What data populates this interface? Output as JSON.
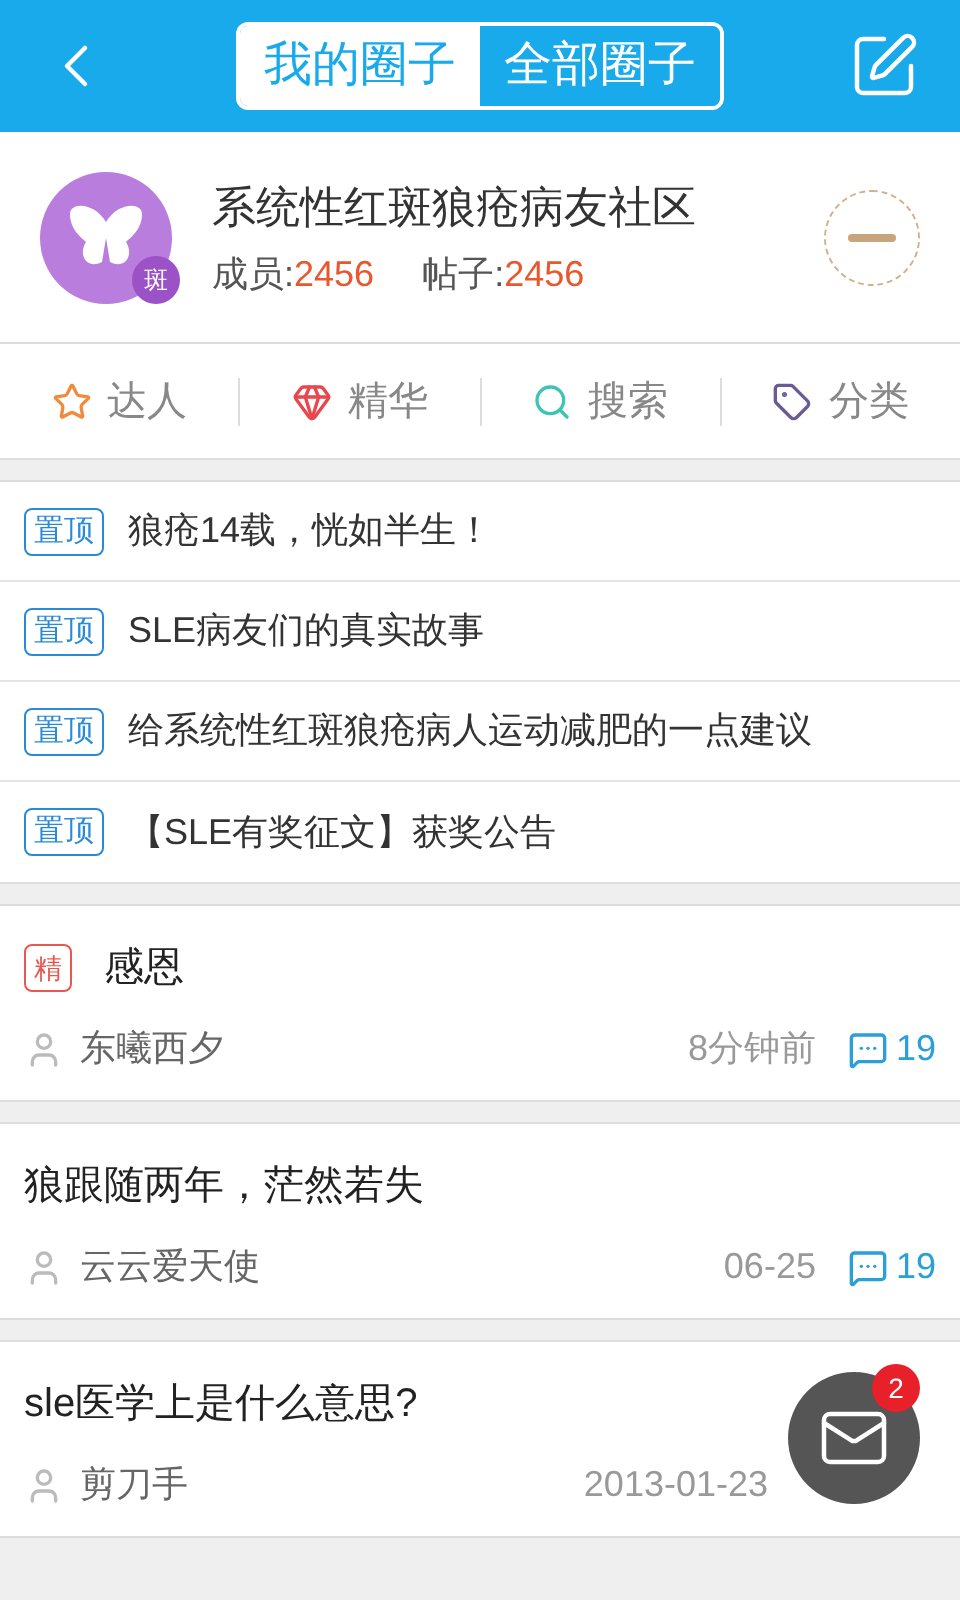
{
  "header": {
    "tabs": [
      {
        "label": "我的圈子",
        "selected": true
      },
      {
        "label": "全部圈子",
        "selected": false
      }
    ]
  },
  "community": {
    "avatar_badge": "斑",
    "name": "系统性红斑狼疮病友社区",
    "members_label": "成员:",
    "members": "2456",
    "posts_label": "帖子:",
    "posts": "2456"
  },
  "actions": [
    {
      "label": "达人",
      "kind": "star"
    },
    {
      "label": "精华",
      "kind": "diamond"
    },
    {
      "label": "搜索",
      "kind": "search"
    },
    {
      "label": "分类",
      "kind": "tag"
    }
  ],
  "pinned": [
    {
      "badge": "置顶",
      "title": "狼疮14载，恍如半生！"
    },
    {
      "badge": "置顶",
      "title": "SLE病友们的真实故事"
    },
    {
      "badge": "置顶",
      "title": "给系统性红斑狼疮病人运动减肥的一点建议"
    },
    {
      "badge": "置顶",
      "title": "【SLE有奖征文】获奖公告"
    }
  ],
  "posts": [
    {
      "badge": "精",
      "title": "感恩",
      "author": "东曦西夕",
      "time": "8分钟前",
      "comments": "19"
    },
    {
      "title": "狼跟随两年，茫然若失",
      "author": "云云爱天使",
      "time": "06-25",
      "comments": "19"
    },
    {
      "title": "sle医学上是什么意思?",
      "author": "剪刀手",
      "time": "2013-01-23"
    }
  ],
  "mail_button": {
    "count": "2"
  }
}
